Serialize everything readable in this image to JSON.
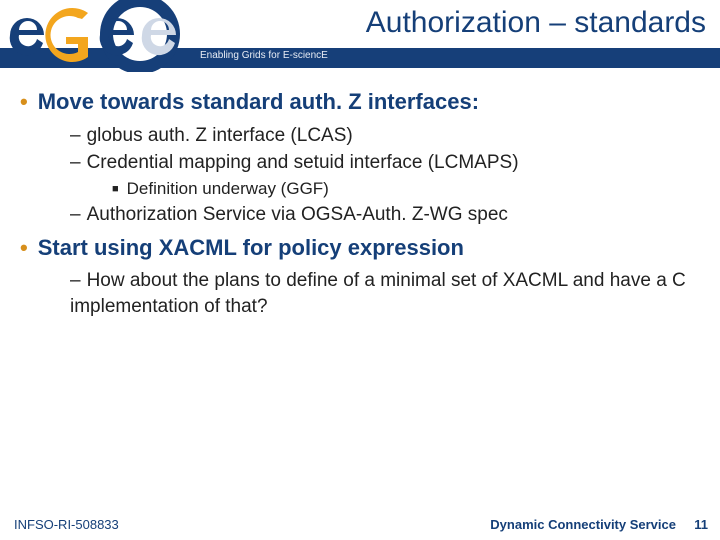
{
  "header": {
    "title": "Authorization – standards",
    "tagline": "Enabling Grids for E-sciencE"
  },
  "logo": {
    "name": "egee-logo"
  },
  "body": {
    "p1": "Move towards standard auth. Z interfaces:",
    "p1a": "globus auth. Z interface (LCAS)",
    "p1b": "Credential mapping and setuid interface (LCMAPS)",
    "p1b1": "Definition underway (GGF)",
    "p1c": "Authorization Service via OGSA-Auth. Z-WG spec",
    "p2": "Start using XACML for policy expression",
    "p2a": "How about the plans to define of a minimal set of XACML and have  a C implementation of that?"
  },
  "footer": {
    "left": "INFSO-RI-508833",
    "right": "Dynamic Connectivity Service",
    "num": "11"
  }
}
